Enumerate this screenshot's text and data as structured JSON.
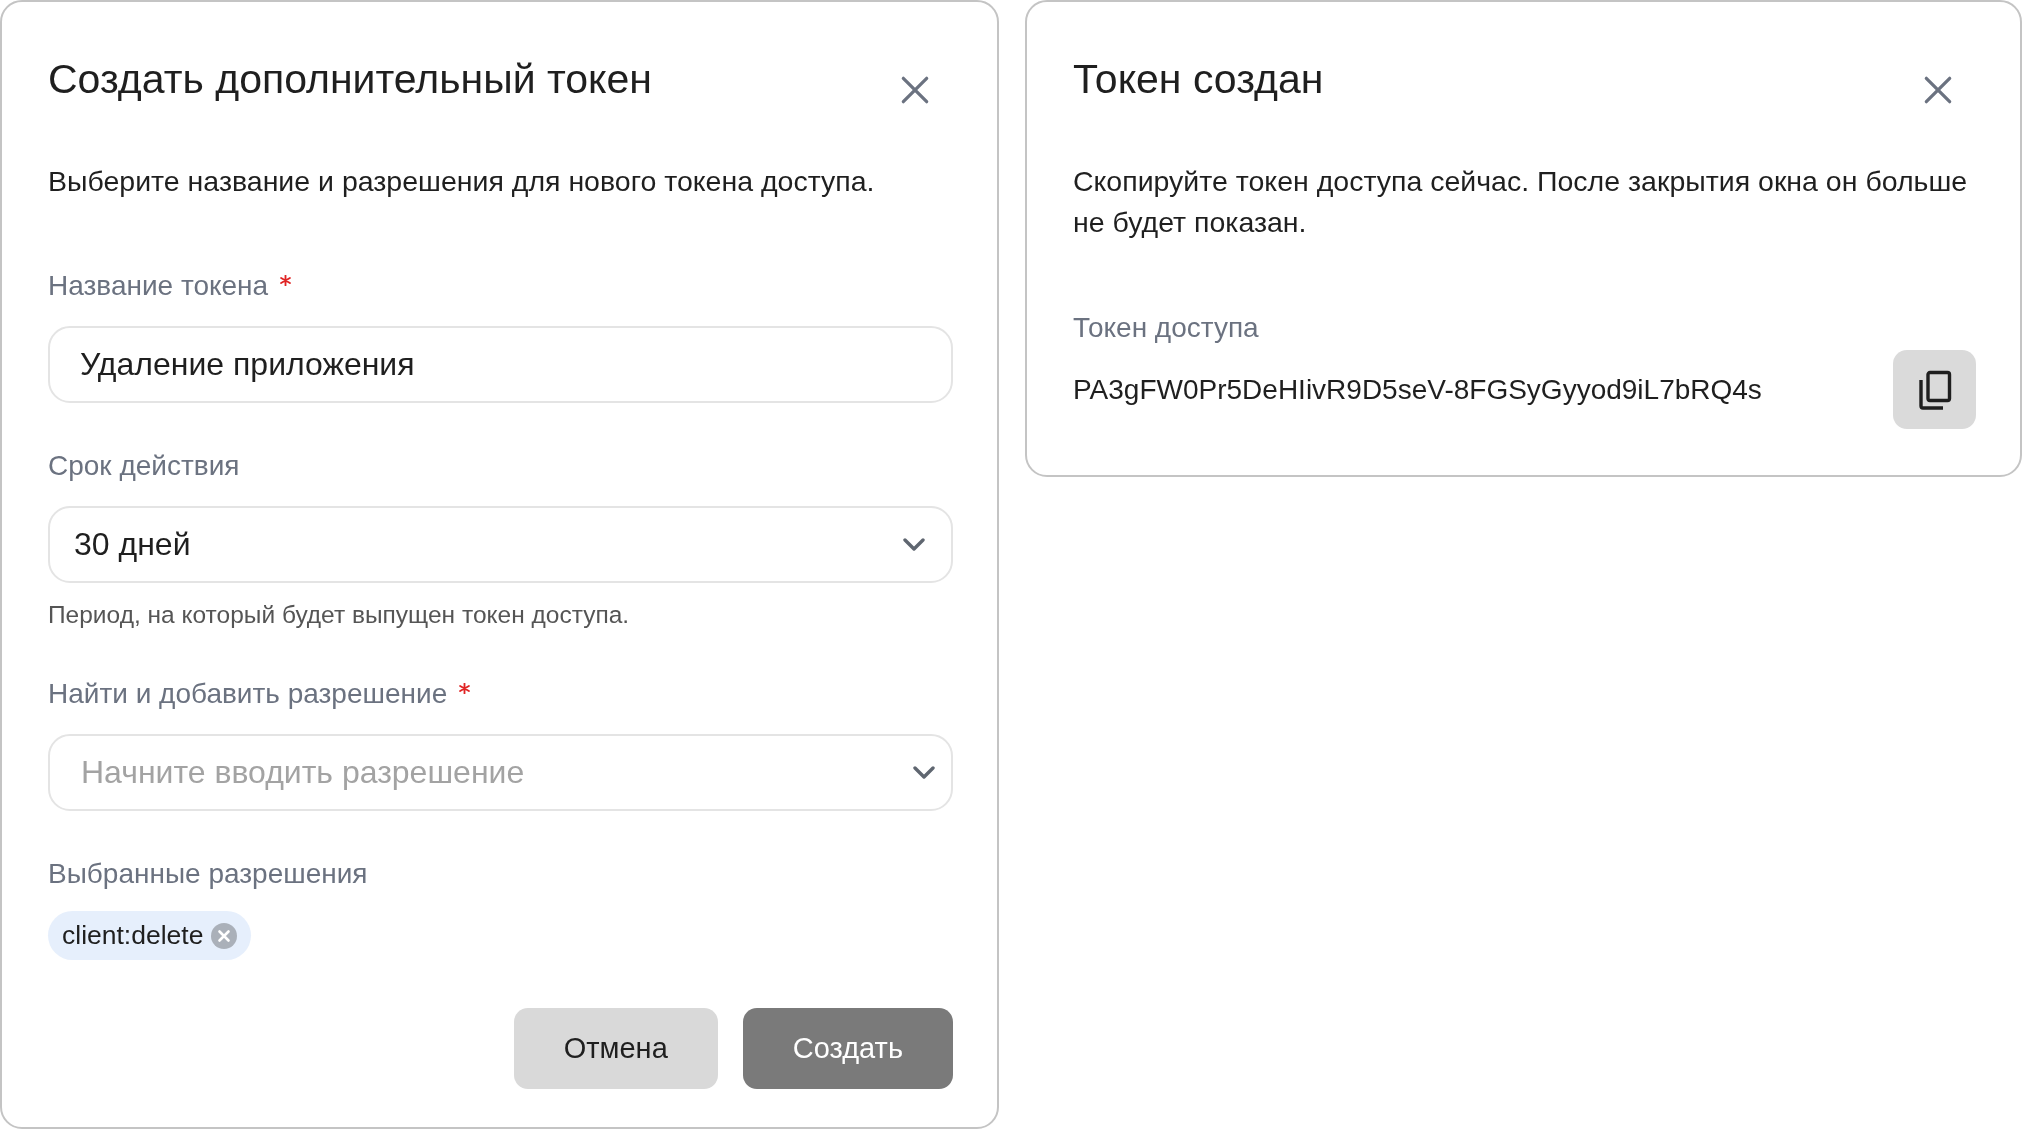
{
  "create_dialog": {
    "title": "Создать дополнительный токен",
    "description": "Выберите название и разрешения для нового токена доступа.",
    "fields": [
      {
        "kind": "text",
        "label": "Название токена",
        "required": true,
        "value": "Удаление приложения"
      },
      {
        "kind": "select",
        "label": "Срок действия",
        "required": false,
        "value": "30 дней",
        "hint": "Период, на который будет выпущен токен доступа."
      },
      {
        "kind": "combobox",
        "label": "Найти и добавить разрешение",
        "required": true,
        "placeholder": "Начните вводить разрешение"
      }
    ],
    "selected_permissions": {
      "label": "Выбранные разрешения",
      "chips": [
        "client:delete"
      ]
    },
    "buttons": [
      {
        "kind": "secondary",
        "label": "Отмена"
      },
      {
        "kind": "primary",
        "label": "Создать"
      }
    ]
  },
  "token_dialog": {
    "title": "Токен создан",
    "description": "Скопируйте токен доступа сейчас. После закрытия окна он больше не будет показан.",
    "token": {
      "label": "Токен доступа",
      "value": "PA3gFW0Pr5DeHIivR9D5seV-8FGSyGyyod9iL7bRQ4s"
    }
  }
}
